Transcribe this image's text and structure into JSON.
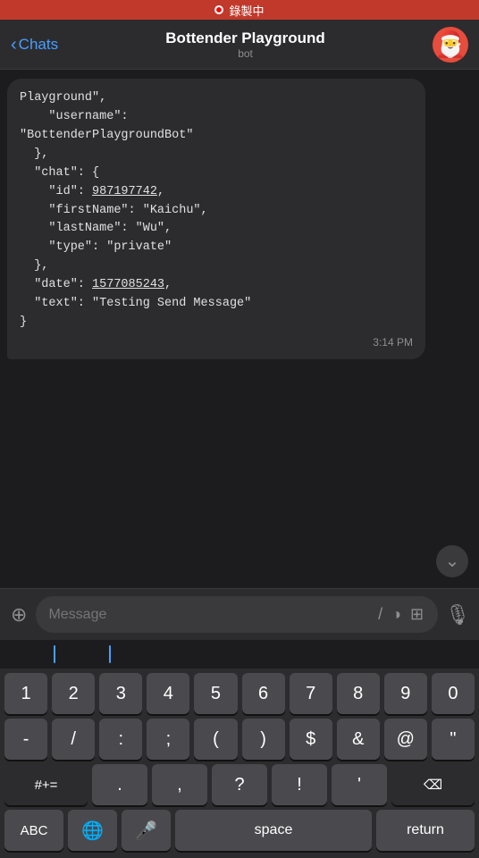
{
  "recording_bar": {
    "label": "錄製中"
  },
  "nav": {
    "back_label": "Chats",
    "title": "Bottender Playground",
    "subtitle": "bot"
  },
  "message": {
    "code_lines": [
      "Playground\",",
      "    \"username\":",
      "\"BottenderPlaygroundBot\"",
      "  },",
      "  \"chat\": {",
      "    \"id\": 987197742,",
      "    \"firstName\": \"Kaichu\",",
      "    \"lastName\": \"Wu\",",
      "    \"type\": \"private\"",
      "  },",
      "  \"date\": 1577085243,",
      "  \"text\": \"Testing Send Message\"",
      "}"
    ],
    "underline_texts": [
      "987197742",
      "1577085243"
    ],
    "time": "3:14 PM"
  },
  "input": {
    "placeholder": "Message"
  },
  "keyboard": {
    "row1": [
      "1",
      "2",
      "3",
      "4",
      "5",
      "6",
      "7",
      "8",
      "9",
      "0"
    ],
    "row2": [
      "-",
      "/",
      ":",
      ";",
      "(",
      ")",
      "$",
      "&",
      "@",
      "\""
    ],
    "row3_left": "#+=",
    "row3_mid": [
      ".",
      ",",
      "?",
      "!",
      "'"
    ],
    "row4": {
      "abc": "ABC",
      "globe": "🌐",
      "mic": "🎤",
      "space": "space",
      "return": "return"
    }
  }
}
